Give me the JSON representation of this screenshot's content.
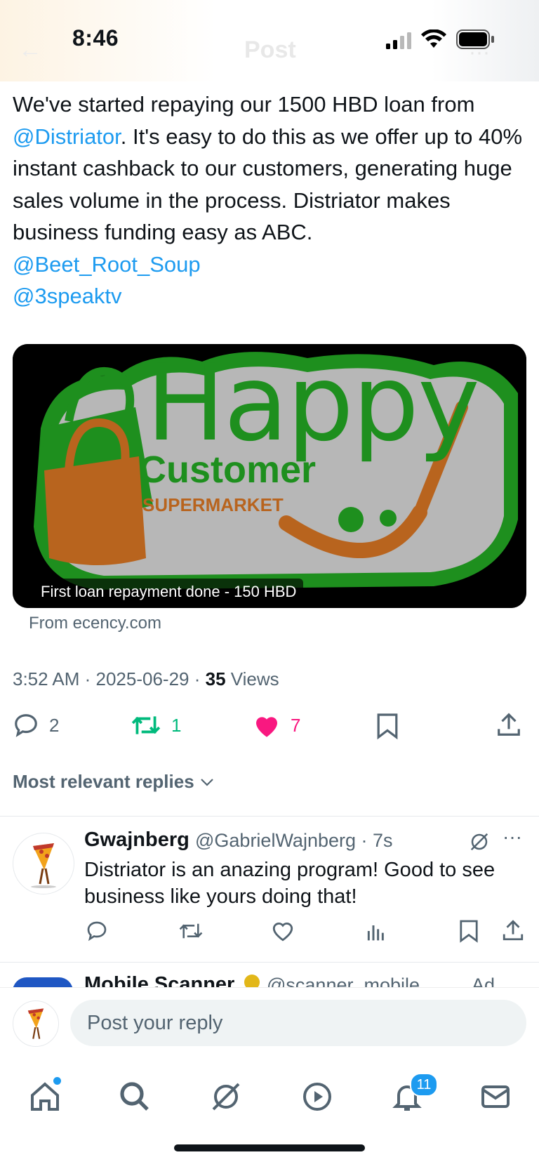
{
  "status_bar": {
    "time": "8:46",
    "header_title_faded": "Post"
  },
  "tweet": {
    "text_line_1": "We've started repaying our 1500 HBD loan from",
    "mention_1": "@Distriator",
    "text_after_mention": ". It's easy to do this as we offer up to 40% instant cashback to our customers, generating huge sales volume in the process. Distriator makes business funding easy as ABC.",
    "mention_2": "@Beet_Root_Soup",
    "mention_3": "@3speaktv",
    "media": {
      "logo_word_1": "Happy",
      "logo_word_2": "Customer",
      "logo_word_3": "SUPERMARKET",
      "caption": "First loan repayment done - 150 HBD",
      "source": "From ecency.com"
    },
    "time": "3:52 AM",
    "date": "2025-06-29",
    "views_count": "35",
    "views_label": "Views",
    "stats": {
      "replies": "2",
      "reposts": "1",
      "likes": "7"
    }
  },
  "replies_header": "Most relevant replies",
  "reply": {
    "name": "Gwajnberg",
    "handle": "@GabrielWajnberg",
    "age": "7s",
    "text": "Distriator is an anazing program! Good to see business like yours doing that!"
  },
  "next_reply_partial": {
    "name": "Mobile Scanner",
    "handle": "@scanner_mobile",
    "tag": "Ad"
  },
  "composer": {
    "placeholder": "Post your reply"
  },
  "tabbar": {
    "notifications_badge": "11"
  },
  "colors": {
    "accent": "#1d9bf0",
    "repost_green": "#00ba7c",
    "like_pink": "#f91880",
    "secondary_text": "#536471",
    "logo_green": "#1e8f1e",
    "logo_orange": "#b8641e"
  }
}
